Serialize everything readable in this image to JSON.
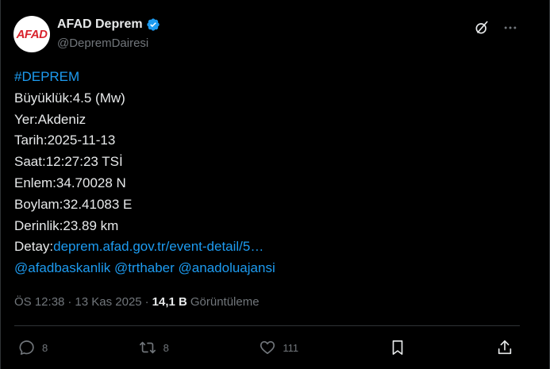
{
  "author": {
    "avatar_text": "AFAD",
    "display_name": "AFAD Deprem",
    "handle": "@DepremDairesi"
  },
  "post": {
    "hashtag": "#DEPREM",
    "lines": [
      "Büyüklük:4.5 (Mw)",
      "Yer:Akdeniz",
      "Tarih:2025-11-13",
      "Saat:12:27:23 TSİ",
      "Enlem:34.70028 N",
      "Boylam:32.41083 E",
      "Derinlik:23.89 km"
    ],
    "detail_label": "Detay:",
    "detail_link": "deprem.afad.gov.tr/event-detail/5…",
    "mentions": [
      "@afadbaskanlik",
      "@trthaber",
      "@anadoluajansi"
    ]
  },
  "meta": {
    "time": "ÖS 12:38",
    "separator": "·",
    "date": "13 Kas 2025",
    "views_count": "14,1 B",
    "views_label": "Görüntüleme"
  },
  "actions": {
    "replies": "8",
    "reposts": "8",
    "likes": "111"
  },
  "colors": {
    "background": "#000000",
    "text": "#e7e9ea",
    "muted": "#71767b",
    "link": "#1d9bf0",
    "divider": "#2f3336",
    "brand_red": "#d9232d"
  },
  "icons": {
    "verified": "verified-badge-icon",
    "grok": "grok-icon",
    "more": "more-icon",
    "reply": "reply-icon",
    "repost": "repost-icon",
    "like": "like-icon",
    "bookmark": "bookmark-icon",
    "share": "share-icon"
  }
}
